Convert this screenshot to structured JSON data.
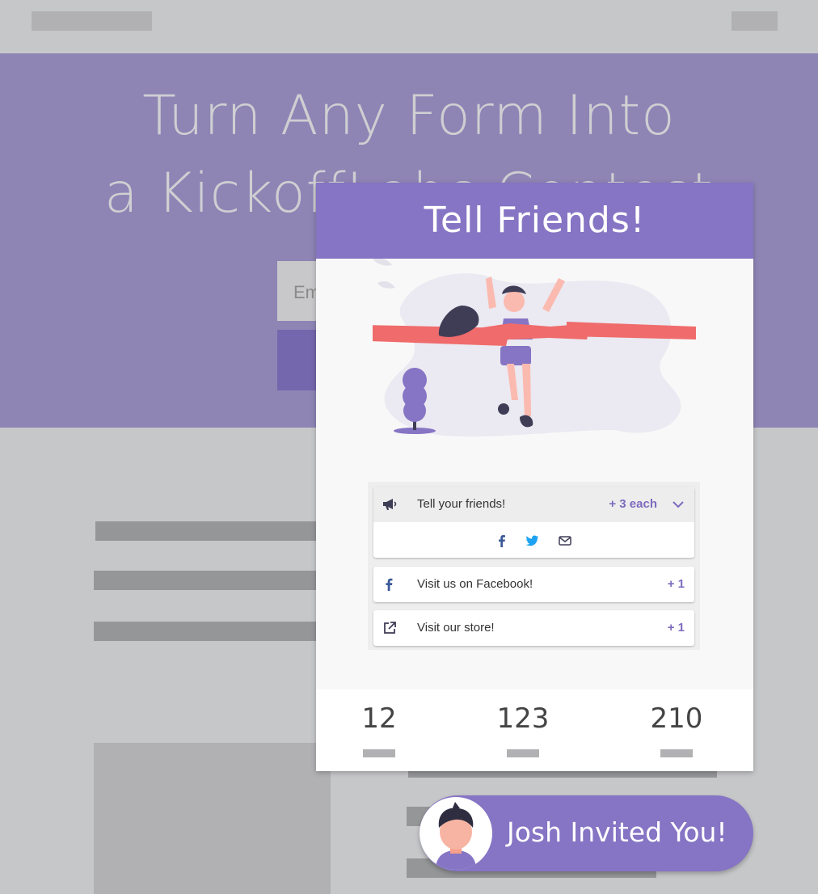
{
  "hero": {
    "title_line1": "Turn Any Form Into",
    "title_line2": "a KickoffLabs Contest",
    "input_placeholder": "Em"
  },
  "modal": {
    "title": "Tell Friends!",
    "actions": [
      {
        "icon": "megaphone-icon",
        "label": "Tell your friends!",
        "points": "+ 3 each",
        "expanded": true
      },
      {
        "icon": "facebook-icon",
        "label": "Visit us on Facebook!",
        "points": "+ 1"
      },
      {
        "icon": "external-link-icon",
        "label": "Visit our store!",
        "points": "+ 1"
      }
    ],
    "share_icons": [
      "facebook-icon",
      "twitter-icon",
      "email-icon"
    ],
    "stats": [
      "12",
      "123",
      "210"
    ]
  },
  "invite": {
    "text": "Josh Invited You!"
  },
  "colors": {
    "brand_purple": "#8674c4",
    "hero_bg": "#8e85b5",
    "ribbon": "#f06b6b",
    "facebook": "#3b5998",
    "twitter": "#1da1f2"
  }
}
